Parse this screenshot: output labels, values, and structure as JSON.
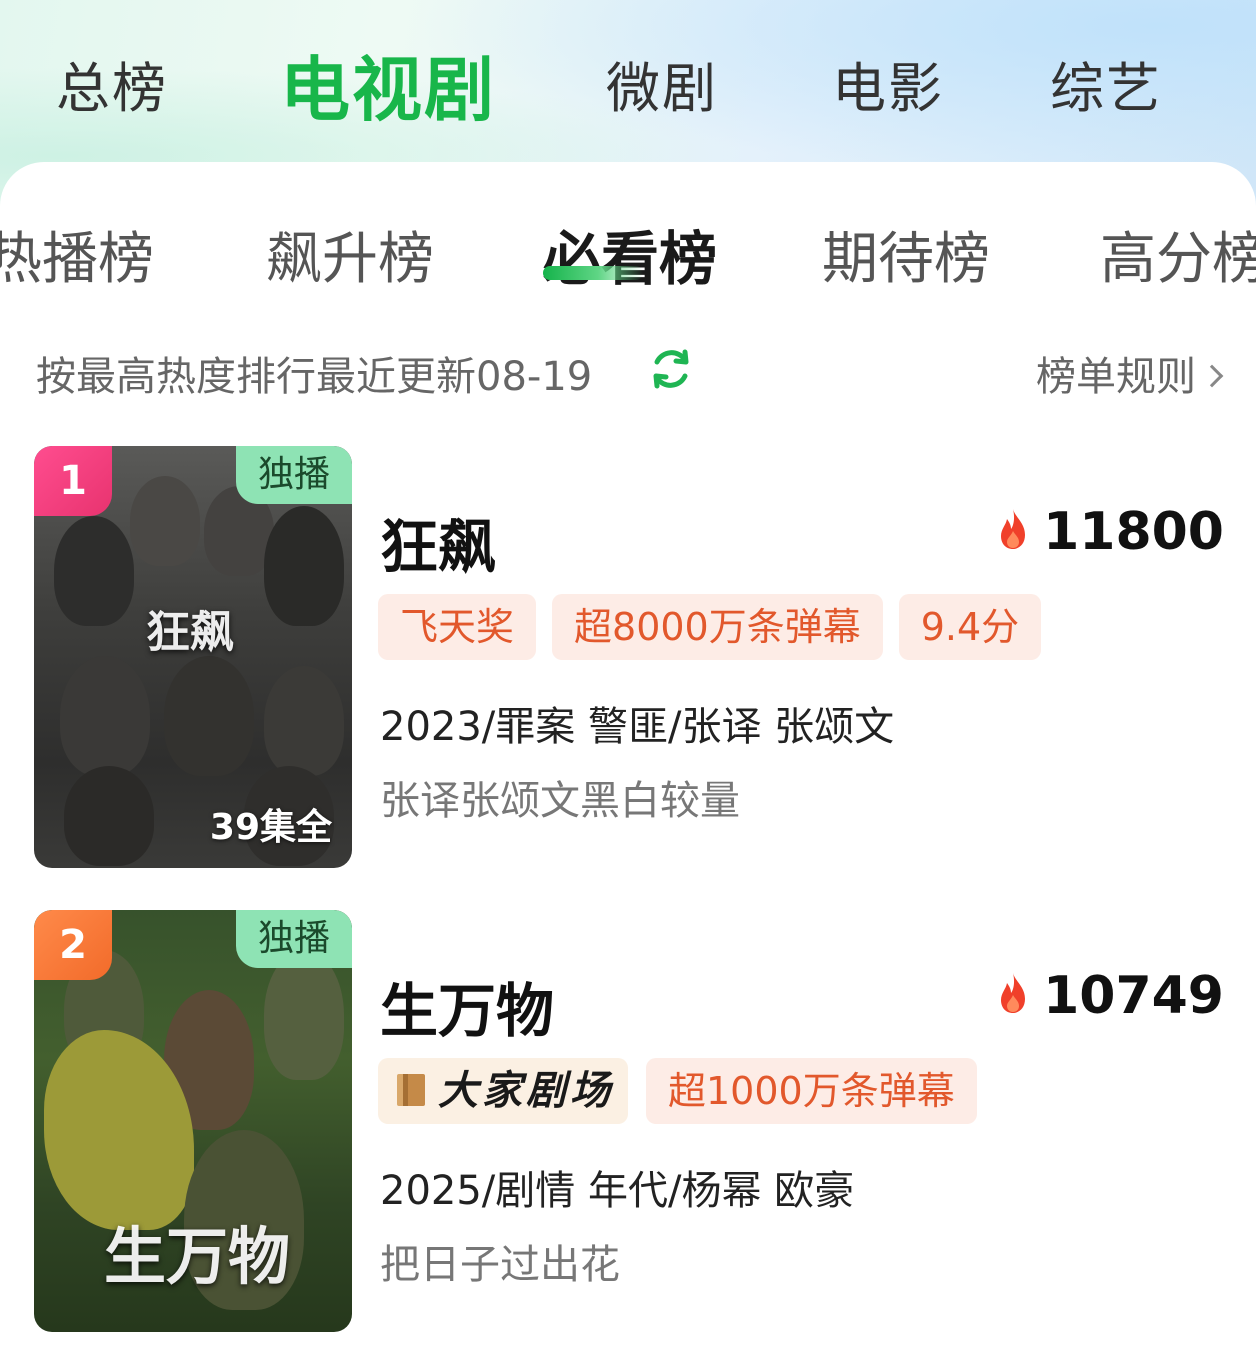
{
  "main_tabs": [
    {
      "label": "总榜"
    },
    {
      "label": "电视剧"
    },
    {
      "label": "微剧"
    },
    {
      "label": "电影"
    },
    {
      "label": "综艺"
    }
  ],
  "sub_tabs": [
    {
      "label": "热播榜"
    },
    {
      "label": "飙升榜"
    },
    {
      "label": "必看榜"
    },
    {
      "label": "期待榜"
    },
    {
      "label": "高分榜"
    }
  ],
  "info": {
    "sort_text": "按最高热度排行最近更新08-19",
    "rules_label": "榜单规则"
  },
  "items": [
    {
      "rank": "1",
      "exclusive": "独播",
      "episodes": "39集全",
      "poster_title": "狂飙",
      "title": "狂飙",
      "heat": "11800",
      "tags": [
        "飞天奖",
        "超8000万条弹幕",
        "9.4分"
      ],
      "meta": "2023/罪案 警匪/张译 张颂文",
      "desc": "张译张颂文黑白较量"
    },
    {
      "rank": "2",
      "exclusive": "独播",
      "poster_title": "生万物",
      "title": "生万物",
      "heat": "10749",
      "theater_tag": "大家剧场",
      "tags": [
        "超1000万条弹幕"
      ],
      "meta": "2025/剧情 年代/杨幂 欧豪",
      "desc": "把日子过出花"
    }
  ],
  "colors": {
    "accent_green": "#18b64a",
    "tag_text": "#e2582c",
    "tag_bg": "#fdece6",
    "rank1": "#e8336f",
    "rank2": "#f26b2a",
    "exclusive_bg": "#8ee3b4"
  }
}
